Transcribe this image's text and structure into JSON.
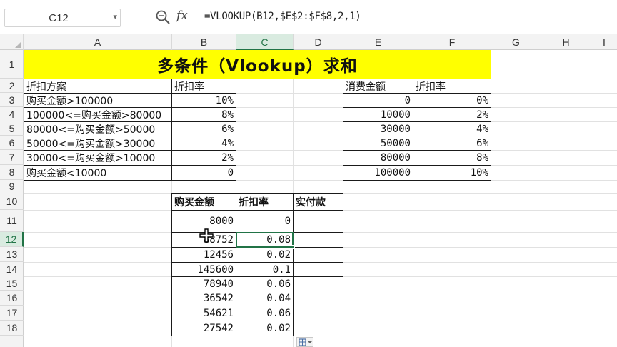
{
  "formula_bar": {
    "name_box": "C12",
    "formula": "=VLOOKUP(B12,$E$2:$F$8,2,1)"
  },
  "columns": [
    "A",
    "B",
    "C",
    "D",
    "E",
    "F",
    "G",
    "H",
    "I"
  ],
  "rows": [
    "1",
    "2",
    "3",
    "4",
    "5",
    "6",
    "7",
    "8",
    "9",
    "10",
    "11",
    "12",
    "13",
    "14",
    "15",
    "16",
    "17",
    "18"
  ],
  "active_cell": "C12",
  "title": "多条件（Vlookup）求和",
  "table1": {
    "headers": [
      "折扣方案",
      "折扣率"
    ],
    "rows": [
      [
        "购买金额>100000",
        "10%"
      ],
      [
        "100000<=购买金额>80000",
        "8%"
      ],
      [
        "80000<=购买金额>50000",
        "6%"
      ],
      [
        "50000<=购买金额>30000",
        "4%"
      ],
      [
        "30000<=购买金额>10000",
        "2%"
      ],
      [
        "购买金额<10000",
        "0"
      ]
    ]
  },
  "table2": {
    "headers": [
      "消费金额",
      "折扣率"
    ],
    "rows": [
      [
        "0",
        "0%"
      ],
      [
        "10000",
        "2%"
      ],
      [
        "30000",
        "4%"
      ],
      [
        "50000",
        "6%"
      ],
      [
        "80000",
        "8%"
      ],
      [
        "100000",
        "10%"
      ]
    ]
  },
  "table3": {
    "headers": [
      "购买金额",
      "折扣率",
      "实付款"
    ],
    "rows": [
      [
        "8000",
        "0",
        ""
      ],
      [
        "88752",
        "0.08",
        ""
      ],
      [
        "12456",
        "0.02",
        ""
      ],
      [
        "145600",
        "0.1",
        ""
      ],
      [
        "78940",
        "0.06",
        ""
      ],
      [
        "36542",
        "0.04",
        ""
      ],
      [
        "54621",
        "0.06",
        ""
      ],
      [
        "27542",
        "0.02",
        ""
      ]
    ]
  },
  "colors": {
    "accent": "#217346",
    "title_fill": "#ffff00"
  },
  "icons": [
    "zoom-icon",
    "fx-icon",
    "cursor-icon",
    "paste-options-icon"
  ]
}
